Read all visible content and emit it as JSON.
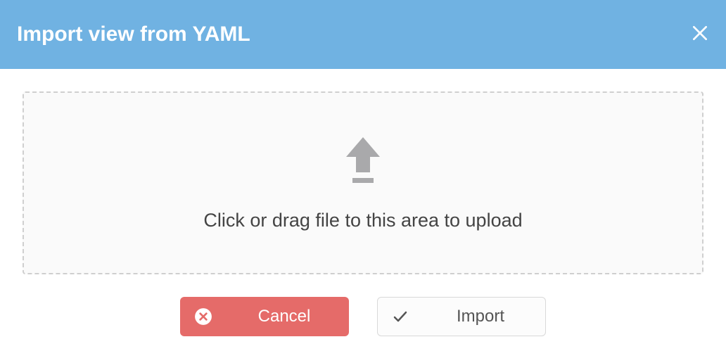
{
  "modal": {
    "title": "Import view from YAML",
    "dropzone": {
      "text": "Click or drag file to this area to upload"
    },
    "buttons": {
      "cancel": "Cancel",
      "import": "Import"
    }
  }
}
